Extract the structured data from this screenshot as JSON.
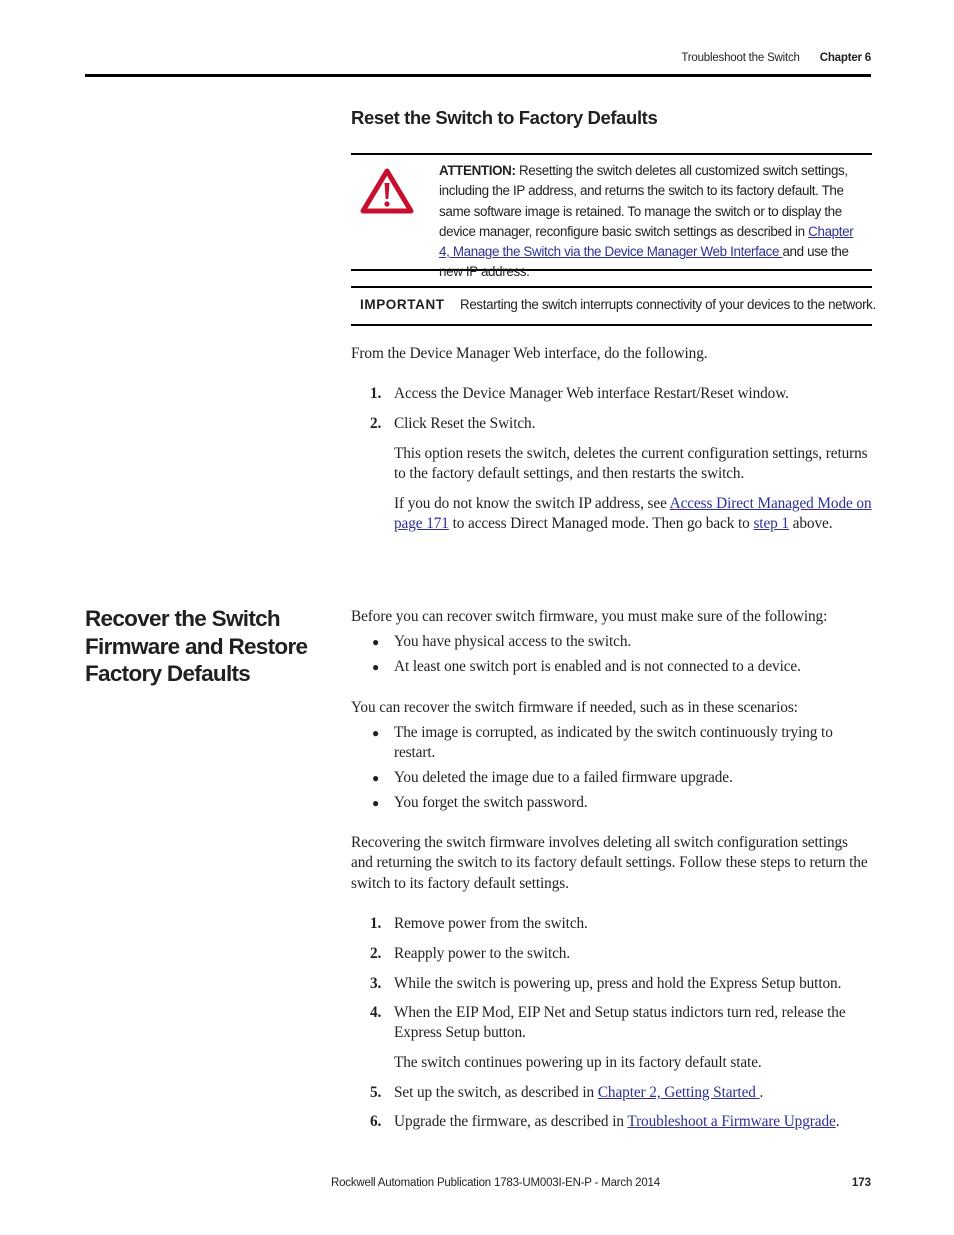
{
  "header": {
    "section": "Troubleshoot the Switch",
    "chapter": "Chapter 6"
  },
  "reset_section": {
    "title": "Reset the Switch to Factory Defaults",
    "attention": {
      "icon": "warning-triangle-icon",
      "icon_color": "#c8102e",
      "label": "ATTENTION:",
      "text": " Resetting the switch deletes all customized switch settings, including the IP address, and returns the switch to its factory default. The same software image is retained. To manage the switch or to display the device manager, reconfigure basic switch settings as described in ",
      "link": "Chapter 4, Manage the Switch via the Device Manager Web Interface ",
      "text_after": " and use the new IP address."
    },
    "important": {
      "label": "IMPORTANT",
      "text": "Restarting the switch interrupts connectivity of your devices to the network."
    },
    "intro": "From the Device Manager Web interface, do the following.",
    "steps": [
      {
        "num": "1.",
        "text": "Access the Device Manager Web interface Restart/Reset window."
      },
      {
        "num": "2.",
        "text": "Click Reset the Switch."
      }
    ],
    "step2_note": "This option resets the switch, deletes the current configuration settings, returns to the factory default settings, and then restarts the switch.",
    "step2_ip": {
      "before": "If you do not know the switch IP address, see ",
      "link1": "Access Direct Managed Mode on page 171",
      "middle": " to access Direct Managed mode. Then go back to ",
      "link2": "step 1",
      "after": " above."
    }
  },
  "recover_section": {
    "title": "Recover the Switch Firmware and Restore Factory Defaults",
    "intro1": "Before you can recover switch firmware, you must make sure of the following:",
    "prereqs": [
      "You have physical access to the switch.",
      "At least one switch port is enabled and is not connected to a device."
    ],
    "intro2": "You can recover the switch firmware if needed, such as in these scenarios:",
    "scenarios": [
      "The image is corrupted, as indicated by the switch continuously trying to restart.",
      "You deleted the image due to a failed firmware upgrade.",
      "You forget the switch password."
    ],
    "intro3": "Recovering the switch firmware involves deleting all switch configuration settings and returning the switch to its factory default settings. Follow these steps to return the switch to its factory default settings.",
    "steps": [
      {
        "num": "1.",
        "text": "Remove power from the switch."
      },
      {
        "num": "2.",
        "text": "Reapply power to the switch."
      },
      {
        "num": "3.",
        "text": "While the switch is powering up, press and hold the Express Setup button."
      },
      {
        "num": "4.",
        "text": "When the EIP Mod, EIP Net and Setup status indictors turn red, release the Express Setup button."
      },
      {
        "num": "5.",
        "text": "Set up the switch, as described in ",
        "link": "Chapter 2, Getting Started ",
        "after": "."
      },
      {
        "num": "6.",
        "text": "Upgrade the firmware, as described in ",
        "link": "Troubleshoot a Firmware Upgrade",
        "after": "."
      }
    ],
    "step4_note": "The switch continues powering up in its factory default state."
  },
  "footer": {
    "publication": "Rockwell Automation Publication 1783-UM003I-EN-P - March 2014",
    "page_number": "173"
  },
  "colors": {
    "link": "#2e3192",
    "text": "#231f20",
    "warning": "#c8102e"
  }
}
